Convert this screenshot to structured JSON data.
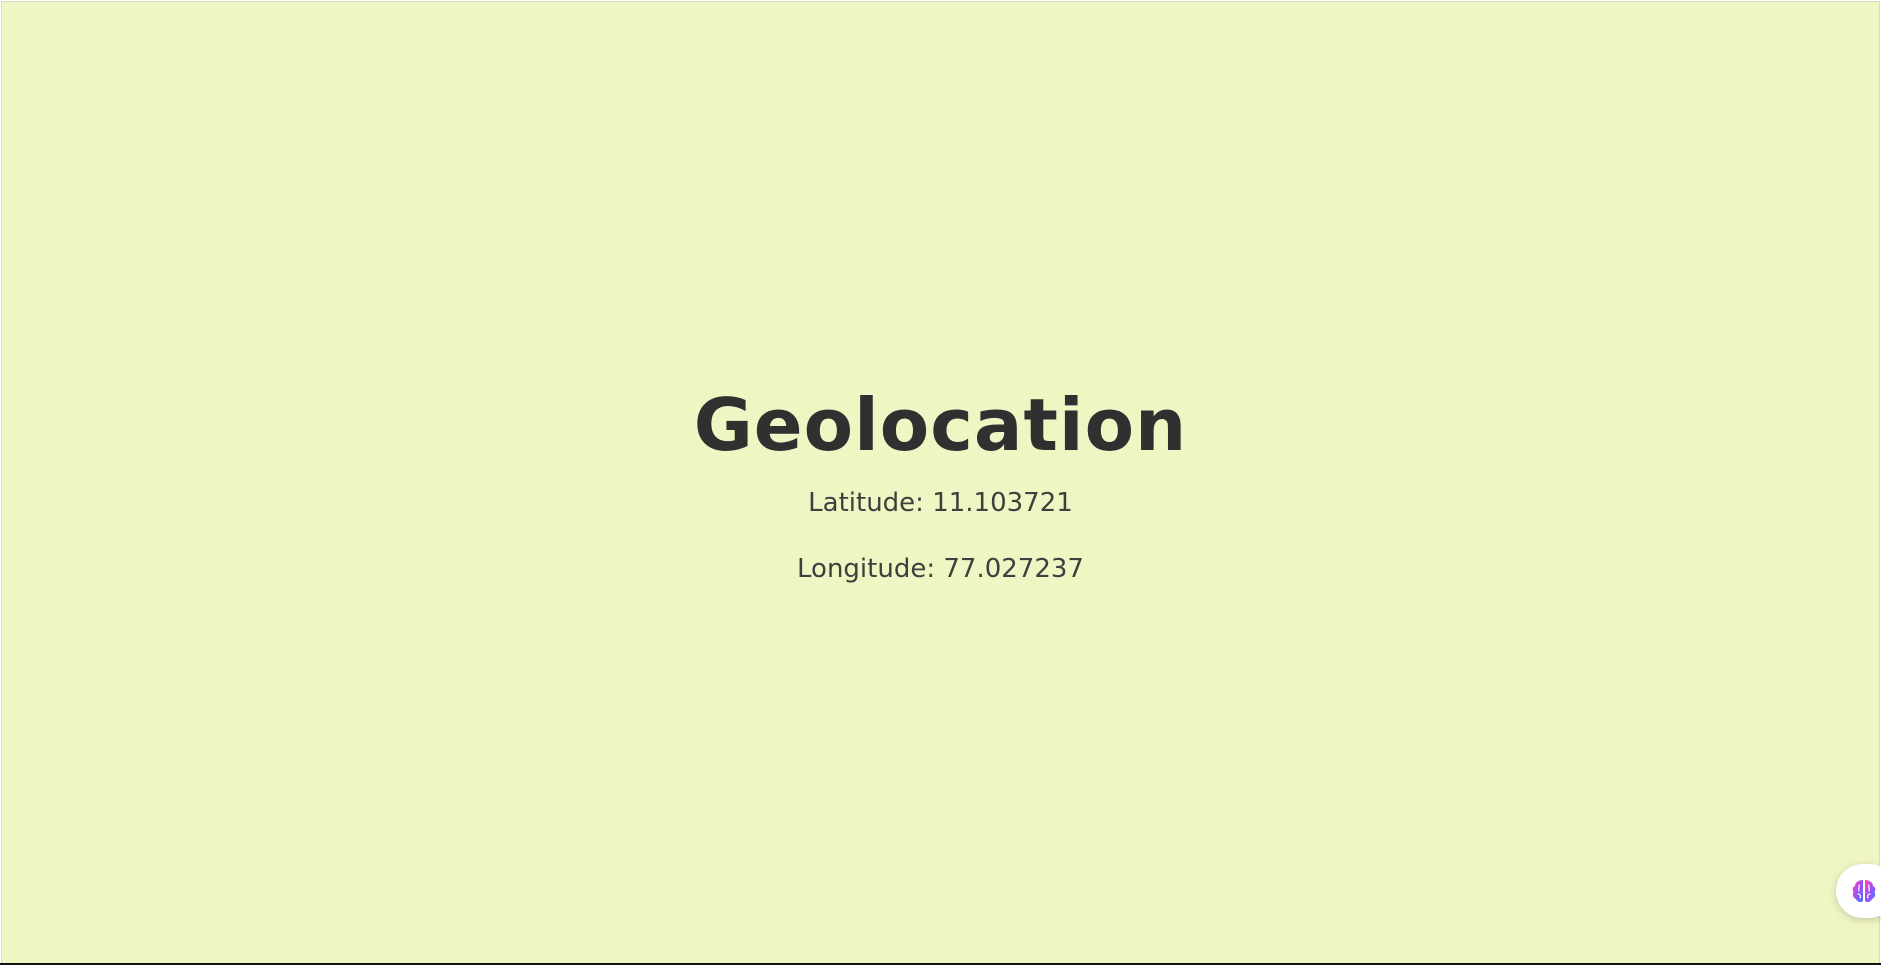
{
  "page": {
    "title": "Geolocation",
    "latitude_text": "Latitude: 11.103721",
    "longitude_text": "Longitude: 77.027237"
  },
  "floating_button": {
    "icon": "brain-icon"
  },
  "colors": {
    "background": "#f0f5c4",
    "heading": "#303030",
    "text": "#3f3f3f"
  }
}
